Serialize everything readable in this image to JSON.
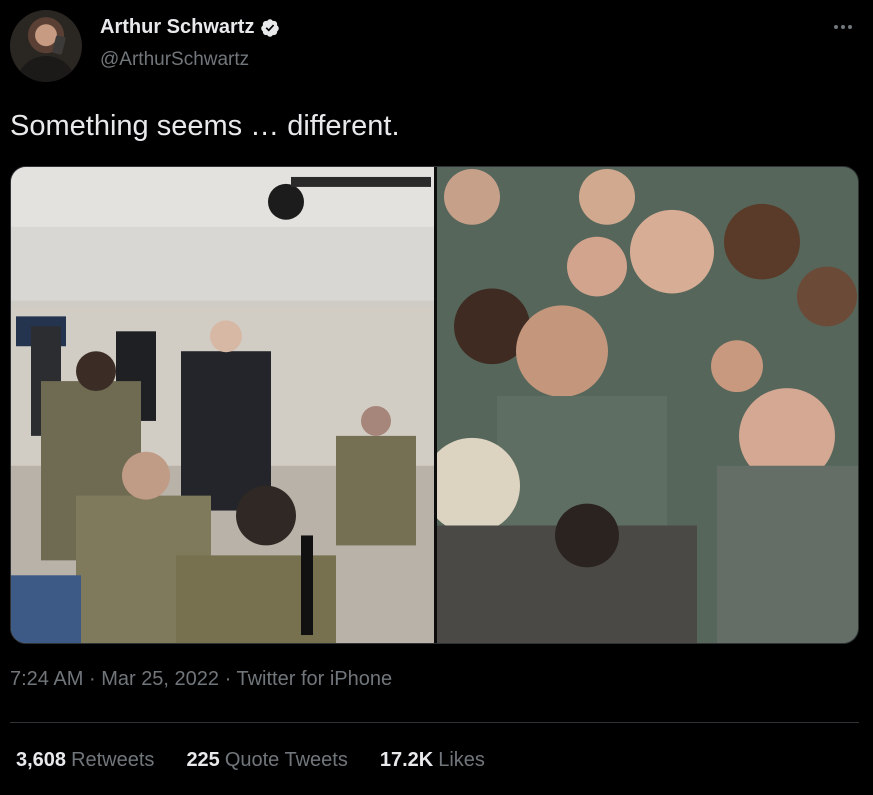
{
  "author": {
    "display_name": "Arthur Schwartz",
    "handle": "@ArthurSchwartz",
    "verified": true,
    "avatar_icon": "profile-photo"
  },
  "tweet": {
    "text": "Something seems … different."
  },
  "media": {
    "images": [
      {
        "icon": "photo-meeting-with-soldiers"
      },
      {
        "icon": "photo-crowd-of-airmen"
      }
    ]
  },
  "meta": {
    "time": "7:24 AM",
    "separator": "·",
    "date": "Mar 25, 2022",
    "source": "Twitter for iPhone"
  },
  "stats": {
    "retweets": {
      "count": "3,608",
      "label": "Retweets"
    },
    "quote_tweets": {
      "count": "225",
      "label": "Quote Tweets"
    },
    "likes": {
      "count": "17.2K",
      "label": "Likes"
    }
  },
  "colors": {
    "background": "#000000",
    "primary_text": "#e7e9ea",
    "secondary_text": "#71767b",
    "border": "#2f3336",
    "verified_badge": "#e7e9ea"
  }
}
